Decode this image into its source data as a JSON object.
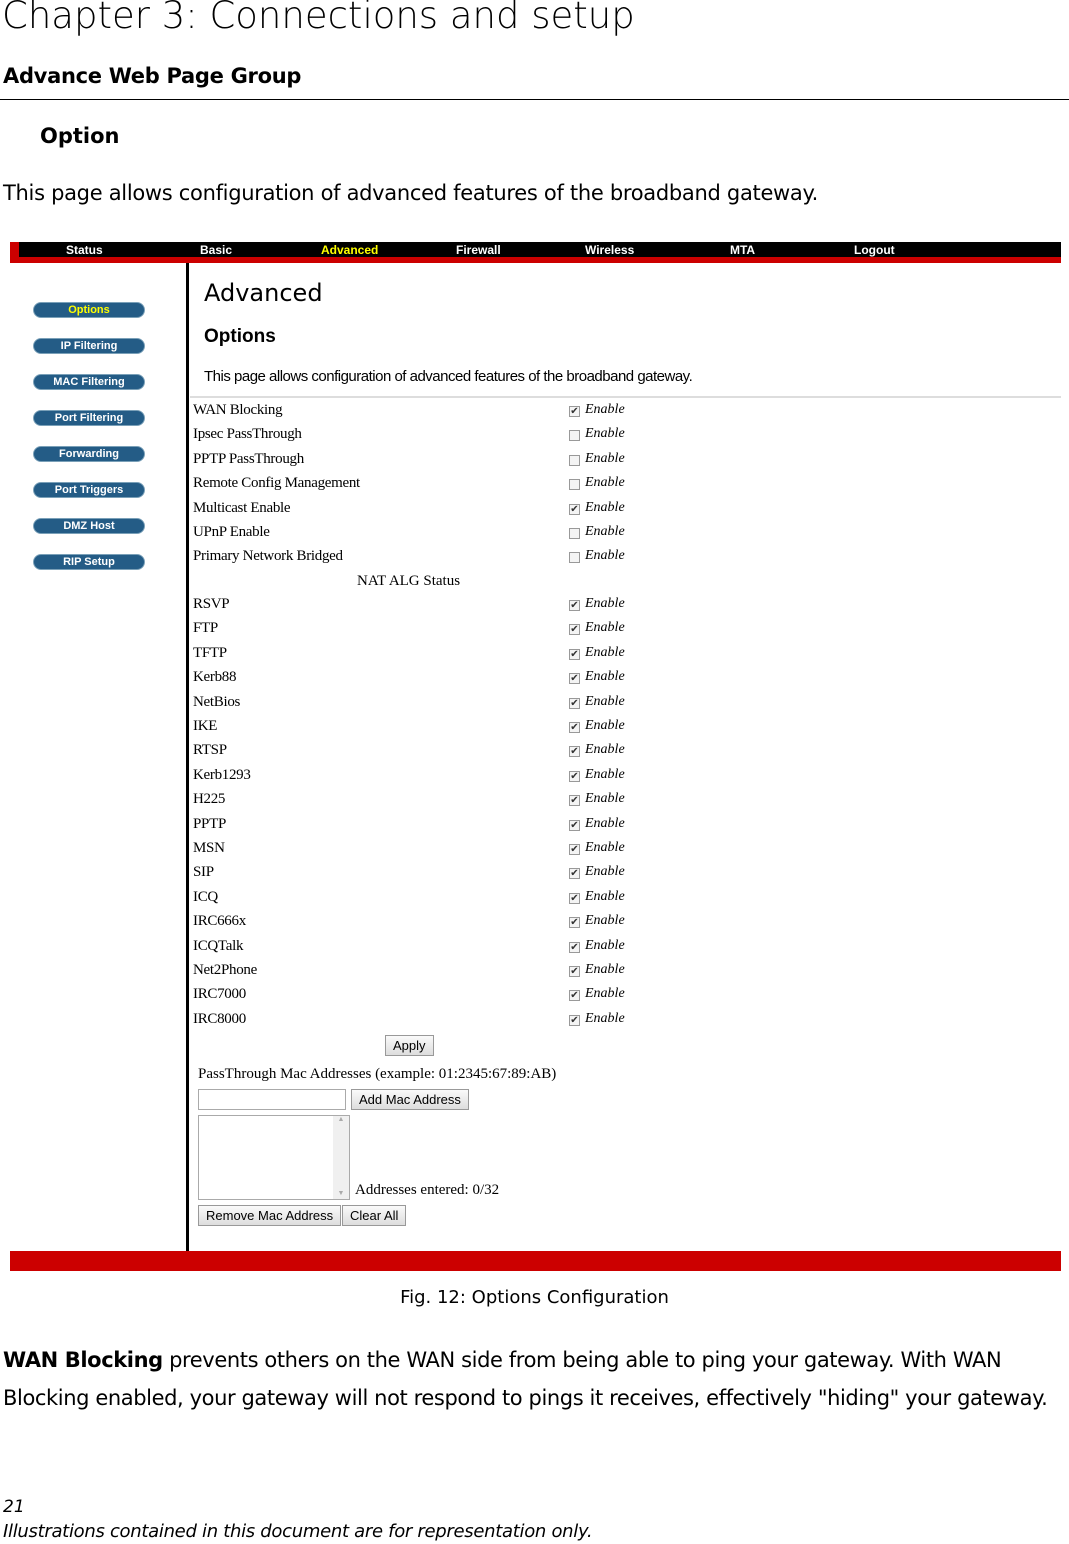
{
  "document": {
    "chapter_title": "Chapter 3: Connections and setup",
    "section_title": "Advance Web Page Group",
    "subsection_title": "Option",
    "intro": "This page allows configuration of advanced features of the broadband gateway.",
    "caption": "Fig. 12: Options Configuration",
    "para_bold": "WAN Blocking",
    "para_text": " prevents others on the WAN side from being able to ping your gateway. With WAN Blocking enabled, your gateway will not respond to pings it receives, effectively \"hiding\" your gateway.",
    "page_number": "21",
    "footer": "Illustrations contained in this document are for representation only."
  },
  "ui": {
    "nav": [
      "Status",
      "Basic",
      "Advanced",
      "Firewall",
      "Wireless",
      "MTA",
      "Logout"
    ],
    "nav_active": "Advanced",
    "sidebar": [
      "Options",
      "IP Filtering",
      "MAC Filtering",
      "Port Filtering",
      "Forwarding",
      "Port Triggers",
      "DMZ Host",
      "RIP Setup"
    ],
    "sidebar_active": "Options",
    "page_title": "Advanced",
    "page_subtitle": "Options",
    "page_desc": "This page allows configuration of advanced features of the broadband gateway.",
    "enable_label": "Enable",
    "options": [
      {
        "label": "WAN Blocking",
        "checked": true
      },
      {
        "label": "Ipsec PassThrough",
        "checked": false
      },
      {
        "label": "PPTP PassThrough",
        "checked": false
      },
      {
        "label": "Remote Config Management",
        "checked": false
      },
      {
        "label": "Multicast Enable",
        "checked": true
      },
      {
        "label": "UPnP Enable",
        "checked": false
      },
      {
        "label": "Primary Network Bridged",
        "checked": false
      }
    ],
    "nat_header": "NAT ALG Status",
    "alg": [
      {
        "label": "RSVP",
        "checked": true
      },
      {
        "label": "FTP",
        "checked": true
      },
      {
        "label": "TFTP",
        "checked": true
      },
      {
        "label": "Kerb88",
        "checked": true
      },
      {
        "label": "NetBios",
        "checked": true
      },
      {
        "label": "IKE",
        "checked": true
      },
      {
        "label": "RTSP",
        "checked": true
      },
      {
        "label": "Kerb1293",
        "checked": true
      },
      {
        "label": "H225",
        "checked": true
      },
      {
        "label": "PPTP",
        "checked": true
      },
      {
        "label": "MSN",
        "checked": true
      },
      {
        "label": "SIP",
        "checked": true
      },
      {
        "label": "ICQ",
        "checked": true
      },
      {
        "label": "IRC666x",
        "checked": true
      },
      {
        "label": "ICQTalk",
        "checked": true
      },
      {
        "label": "Net2Phone",
        "checked": true
      },
      {
        "label": "IRC7000",
        "checked": true
      },
      {
        "label": "IRC8000",
        "checked": true
      }
    ],
    "apply": "Apply",
    "mac_label": "PassThrough Mac Addresses (example: 01:2345:67:89:AB)",
    "mac_input_value": "",
    "add_mac": "Add Mac Address",
    "addresses_entered": "Addresses entered: 0/32",
    "remove_mac": "Remove Mac Address",
    "clear_all": "Clear All",
    "colors": {
      "nav_bg": "#000000",
      "accent_red": "#cc0000",
      "active": "#ffff00",
      "sidebar_button": "#245c86"
    }
  }
}
